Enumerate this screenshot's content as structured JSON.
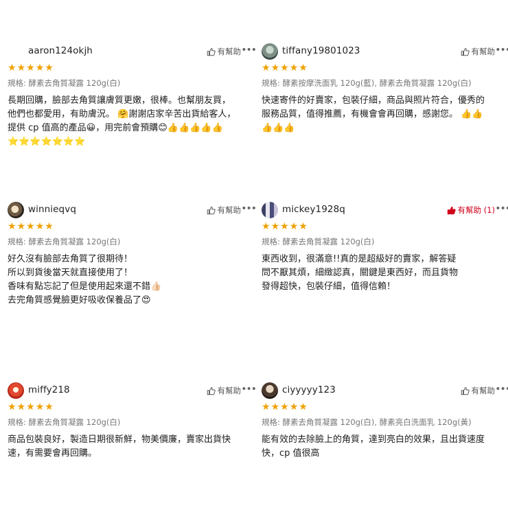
{
  "reviews": [
    {
      "username": "aaron124okjh",
      "helpful_label": "有幫助",
      "more": "•••",
      "stars": [
        "★",
        "★",
        "★",
        "★",
        "★"
      ],
      "variation": "規格: 酵素去角質凝露 120g(白)",
      "comment": "長期回購，臉部去角質讓膚質更嫩，很棒。也幫朋友買，\n他們也都愛用，有助膚況。 🤗謝謝店家辛苦出貨給客人，\n提供 cp 值高的產品😀，用完前會預購😊👍👍👍👍👍\n⭐⭐⭐⭐⭐⭐⭐"
    },
    {
      "username": "tiffany19801023",
      "helpful_label": "有幫助",
      "more": "•••",
      "stars": [
        "★",
        "★",
        "★",
        "★",
        "★"
      ],
      "variation": "規格: 酵素按摩洗面乳 120g(藍), 酵素去角質凝露 120g(白)",
      "comment": "快速寄件的好賣家，包裝仔細，商品與照片符合，優秀的\n服務品質，值得推薦，有機會會再回購，感謝您。 👍👍\n👍👍👍"
    },
    {
      "username": "winnieqvq",
      "helpful_label": "有幫助",
      "more": "•••",
      "stars": [
        "★",
        "★",
        "★",
        "★",
        "★"
      ],
      "variation": "規格: 酵素去角質凝露 120g(白)",
      "comment": "好久沒有臉部去角質了很期待！\n所以到貨後當天就直接使用了！\n香味有點忘記了但是使用起來還不錯👍🏻\n去完角質感覺臉更好吸收保養品了😍"
    },
    {
      "username": "mickey1928q",
      "helpful_label": "有幫助 (1)",
      "more": "•••",
      "stars": [
        "★",
        "★",
        "★",
        "★",
        "★"
      ],
      "variation": "規格: 酵素去角質凝露 120g(白)",
      "comment": "東西收到，很滿意!!真的是超級好的賣家，解答疑\n問不厭其煩，細緻認真，關鍵是東西好，而且貨物\n發得超快，包裝仔細，值得信賴！"
    },
    {
      "username": "miffy218",
      "helpful_label": "有幫助",
      "more": "•••",
      "stars": [
        "★",
        "★",
        "★",
        "★",
        "★"
      ],
      "variation": "規格: 酵素去角質凝露 120g(白)",
      "comment": "商品包裝良好，製造日期很新鮮，物美價廉，賣家出貨快\n速，有需要會再回購。"
    },
    {
      "username": "ciyyyyy123",
      "helpful_label": "有幫助",
      "more": "•••",
      "stars": [
        "★",
        "★",
        "★",
        "★",
        "★"
      ],
      "variation": "規格: 酵素去角質凝露 120g(白), 酵素亮白洗面乳 120g(黃)",
      "comment": "能有效的去除臉上的角質，達到亮白的效果，且出貨速度\n快，cp 值很高"
    }
  ],
  "colors": {
    "star": "#f0a000",
    "helpful_active": "#d0011b",
    "muted": "#777777"
  }
}
